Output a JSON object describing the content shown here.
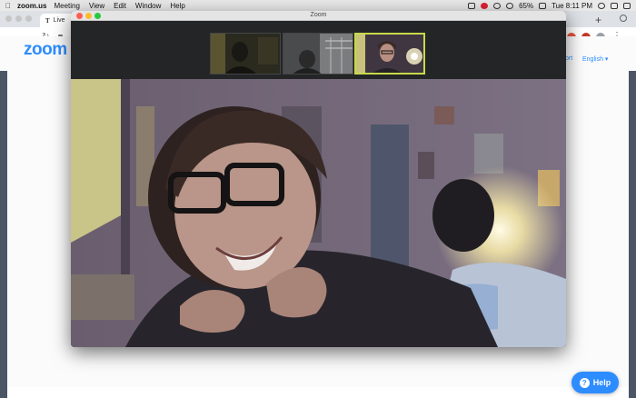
{
  "menubar": {
    "app_name": "zoom.us",
    "items": [
      "Meeting",
      "View",
      "Edit",
      "Window",
      "Help"
    ],
    "battery": "65%",
    "clock": "Tue 8:11 PM"
  },
  "browser": {
    "tab_title": "Live",
    "tab_favicon": "T",
    "new_tab": "+"
  },
  "site": {
    "logo": "zoom",
    "nav_support": "ort",
    "nav_language": "English"
  },
  "zoom_window": {
    "title": "Zoom",
    "thumbnails": [
      "participant-1",
      "participant-2",
      "participant-3-active"
    ]
  },
  "help_button": {
    "label": "Help",
    "icon": "?"
  },
  "colors": {
    "zoom_blue": "#2d8cff",
    "active_speaker_border": "#c9d94a",
    "traffic_red": "#fe5f57",
    "traffic_yellow": "#febc2e",
    "traffic_green": "#28c840"
  },
  "icons": [
    "apple-icon",
    "battery-icon",
    "wifi-icon",
    "search-icon",
    "siri-icon",
    "lock-icon",
    "back-arrow-icon",
    "forward-arrow-icon",
    "reload-icon",
    "kebab-menu-icon",
    "question-icon"
  ]
}
